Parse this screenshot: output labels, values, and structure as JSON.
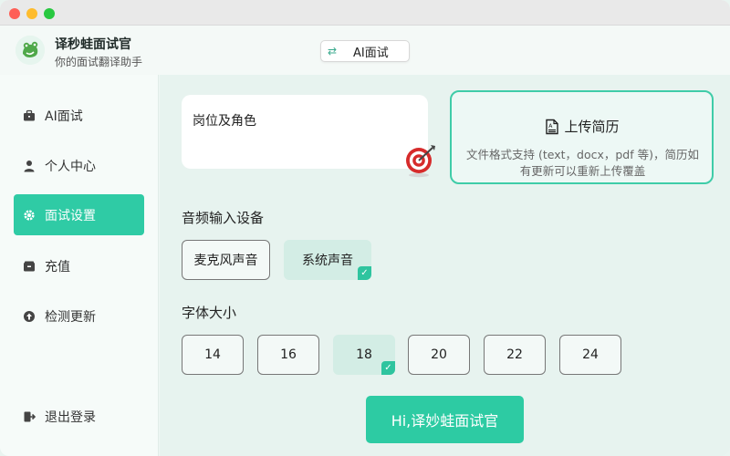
{
  "app": {
    "name": "译秒蛙面试官",
    "subtitle": "你的面试翻译助手",
    "mode_label": "AI面试"
  },
  "sidebar": {
    "items": [
      {
        "label": "AI面试",
        "icon": "briefcase-icon",
        "active": false
      },
      {
        "label": "个人中心",
        "icon": "person-icon",
        "active": false
      },
      {
        "label": "面试设置",
        "icon": "gear-icon",
        "active": true
      },
      {
        "label": "充值",
        "icon": "wallet-icon",
        "active": false
      },
      {
        "label": "检测更新",
        "icon": "upload-circle-icon",
        "active": false
      }
    ],
    "logout_label": "退出登录"
  },
  "main": {
    "role_card_title": "岗位及角色",
    "upload": {
      "title": "上传简历",
      "description": "文件格式支持 (text，docx，pdf 等)，简历如有更新可以重新上传覆盖"
    },
    "audio": {
      "label": "音频输入设备",
      "options": [
        "麦克风声音",
        "系统声音"
      ],
      "selected": "系统声音"
    },
    "font": {
      "label": "字体大小",
      "options": [
        "14",
        "16",
        "18",
        "20",
        "22",
        "24"
      ],
      "selected": "18"
    },
    "cta_label": "Hi,译妙蛙面试官"
  },
  "colors": {
    "accent": "#2fcba5",
    "background": "#e7f3ef",
    "sidebar": "#f6fbf9"
  }
}
